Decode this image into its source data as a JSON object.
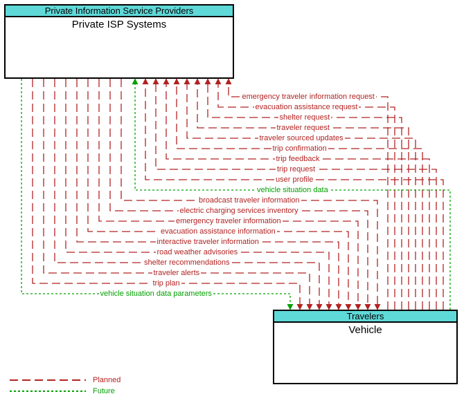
{
  "source_node": {
    "header": "Private Information Service Providers",
    "title": "Private ISP Systems"
  },
  "target_node": {
    "header": "Travelers",
    "title": "Vehicle"
  },
  "chart_data": {
    "type": "flow-diagram",
    "styles": {
      "Planned": {
        "color": "#b22222",
        "dash": "long"
      },
      "Future": {
        "color": "#00a000",
        "dash": "short"
      }
    },
    "flows_to_source": [
      {
        "label": "emergency traveler information request",
        "style": "Planned"
      },
      {
        "label": "evacuation assistance request",
        "style": "Planned"
      },
      {
        "label": "shelter request",
        "style": "Planned"
      },
      {
        "label": "traveler request",
        "style": "Planned"
      },
      {
        "label": "traveler sourced updates",
        "style": "Planned"
      },
      {
        "label": "trip confirmation",
        "style": "Planned"
      },
      {
        "label": "trip feedback",
        "style": "Planned"
      },
      {
        "label": "trip request",
        "style": "Planned"
      },
      {
        "label": "user profile",
        "style": "Planned"
      },
      {
        "label": "vehicle situation data",
        "style": "Future"
      }
    ],
    "flows_to_target": [
      {
        "label": "broadcast traveler information",
        "style": "Planned"
      },
      {
        "label": "electric charging services inventory",
        "style": "Planned"
      },
      {
        "label": "emergency traveler information",
        "style": "Planned"
      },
      {
        "label": "evacuation assistance information",
        "style": "Planned"
      },
      {
        "label": "interactive traveler information",
        "style": "Planned"
      },
      {
        "label": "road weather advisories",
        "style": "Planned"
      },
      {
        "label": "shelter recommendations",
        "style": "Planned"
      },
      {
        "label": "traveler alerts",
        "style": "Planned"
      },
      {
        "label": "trip plan",
        "style": "Planned"
      },
      {
        "label": "vehicle situation data parameters",
        "style": "Future"
      }
    ]
  },
  "legend": {
    "items": [
      {
        "label": "Planned",
        "style": "Planned"
      },
      {
        "label": "Future",
        "style": "Future"
      }
    ]
  }
}
